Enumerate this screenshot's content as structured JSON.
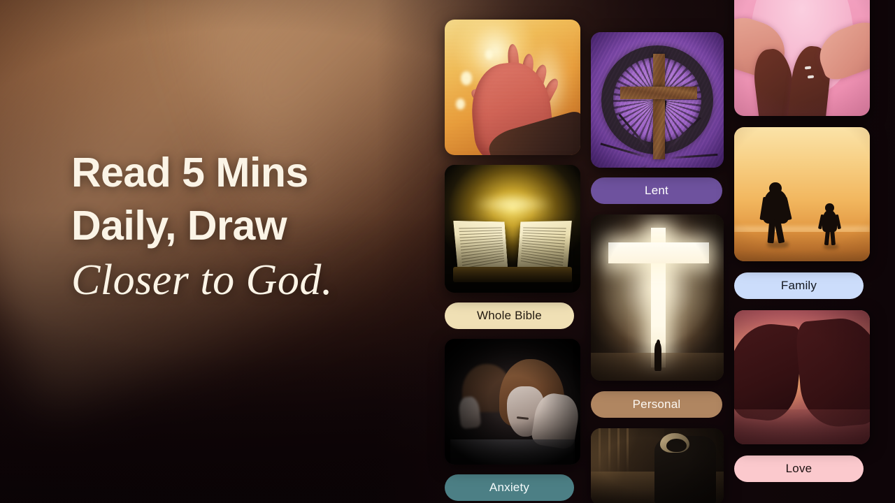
{
  "background": {
    "accent_warm": "#8a5c39",
    "accent_dark": "#17090a"
  },
  "headline": {
    "line1": "Read 5 Mins",
    "line2": "Daily, Draw",
    "line3": "Closer to God."
  },
  "grid": {
    "columns": [
      {
        "id": "column-left",
        "cards": [
          {
            "id": "card-reaching-hand",
            "image_name": "hand-reaching-into-light-image",
            "label": null,
            "pill_bg": null,
            "pill_text": null
          },
          {
            "id": "card-whole-bible",
            "image_name": "open-glowing-bible-image",
            "label": "Whole Bible",
            "pill_bg": "#f0e0b5",
            "pill_text": "#221a10"
          },
          {
            "id": "card-anxiety",
            "image_name": "distressed-woman-double-exposure-image",
            "label": "Anxiety",
            "pill_bg": "#4c7f85",
            "pill_text": "#f4fbfb"
          }
        ]
      },
      {
        "id": "column-middle",
        "cards": [
          {
            "id": "card-lent",
            "image_name": "crown-of-thorns-with-cross-image",
            "label": "Lent",
            "pill_bg": "#6e529e",
            "pill_text": "#ffffff"
          },
          {
            "id": "card-personal",
            "image_name": "glowing-cross-doorway-image",
            "label": "Personal",
            "pill_bg": "#b08661",
            "pill_text": "#fdf8f2"
          },
          {
            "id": "card-dark-figure",
            "image_name": "person-in-dim-corridor-image",
            "label": null,
            "pill_bg": null,
            "pill_text": null
          }
        ]
      },
      {
        "id": "column-right",
        "cards": [
          {
            "id": "card-pink-hands",
            "image_name": "hands-on-pink-heart-image",
            "label": null,
            "pill_bg": null,
            "pill_text": null
          },
          {
            "id": "card-family",
            "image_name": "father-and-child-beach-silhouette-image",
            "label": "Family",
            "pill_bg": "#ccddfb",
            "pill_text": "#14181f"
          },
          {
            "id": "card-love",
            "image_name": "hands-heart-sunset-image",
            "label": "Love",
            "pill_bg": "#fbc9cd",
            "pill_text": "#1d1212"
          }
        ]
      }
    ]
  }
}
